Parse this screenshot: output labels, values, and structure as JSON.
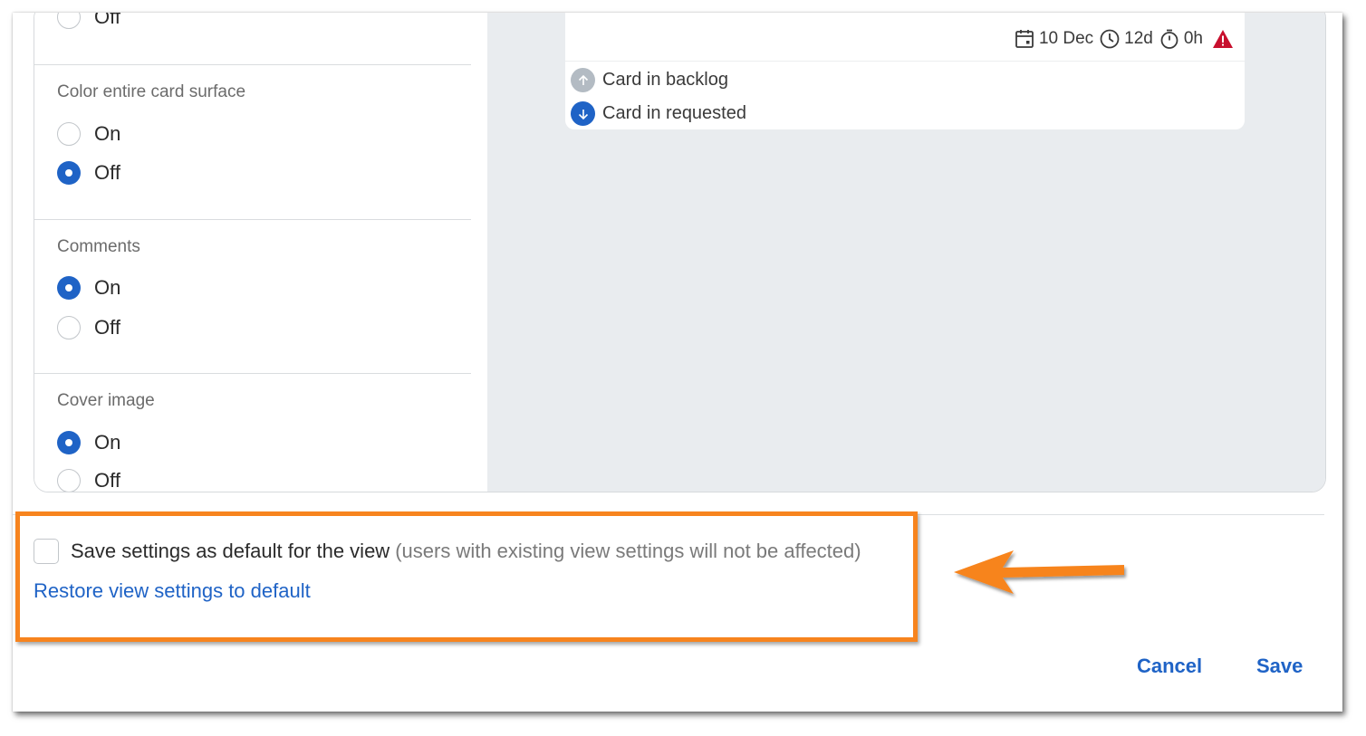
{
  "settings": {
    "top_partial": {
      "off_label": "Off"
    },
    "color_surface": {
      "title": "Color entire card surface",
      "on_label": "On",
      "off_label": "Off",
      "selected": "Off"
    },
    "comments": {
      "title": "Comments",
      "on_label": "On",
      "off_label": "Off",
      "selected": "On"
    },
    "cover_image": {
      "title": "Cover image",
      "on_label": "On",
      "off_label": "Off",
      "selected": "On"
    }
  },
  "preview": {
    "date": "10 Dec",
    "age": "12d",
    "time": "0h",
    "rows": [
      {
        "label": "Card in backlog",
        "icon": "arrow-up-icon"
      },
      {
        "label": "Card in requested",
        "icon": "arrow-down-icon"
      }
    ]
  },
  "footer": {
    "save_default_label": "Save settings as default for the view",
    "save_default_note": "(users with existing view settings will not be affected)",
    "save_default_checked": false,
    "restore_link": "Restore view settings to default",
    "cancel_label": "Cancel",
    "save_label": "Save"
  },
  "colors": {
    "accent": "#1f63c6",
    "highlight": "#f7841e",
    "warning": "#c8102e",
    "preview_bg": "#e9ecef"
  }
}
